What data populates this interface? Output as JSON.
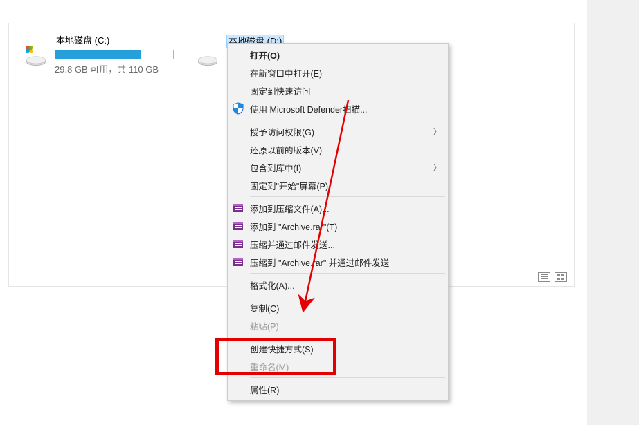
{
  "drives": {
    "c": {
      "label": "本地磁盘 (C:)",
      "subtext": "29.8 GB 可用，共 110 GB",
      "fill_percent": 73
    },
    "d": {
      "label": "本地磁盘 (D:)"
    }
  },
  "menu": {
    "open": "打开(O)",
    "open_new": "在新窗口中打开(E)",
    "pin_quick": "固定到快速访问",
    "defender": "使用 Microsoft Defender扫描...",
    "grant_access": "授予访问权限(G)",
    "prev_versions": "还原以前的版本(V)",
    "include_lib": "包含到库中(I)",
    "pin_start": "固定到\"开始\"屏幕(P)",
    "rar_add": "添加到压缩文件(A)...",
    "rar_add_to": "添加到 \"Archive.rar\"(T)",
    "rar_mail": "压缩并通过邮件发送...",
    "rar_to_mail": "压缩到 \"Archive.rar\" 并通过邮件发送",
    "format": "格式化(A)...",
    "copy": "复制(C)",
    "paste": "粘贴(P)",
    "shortcut": "创建快捷方式(S)",
    "rename": "重命名(M)",
    "properties": "属性(R)"
  }
}
